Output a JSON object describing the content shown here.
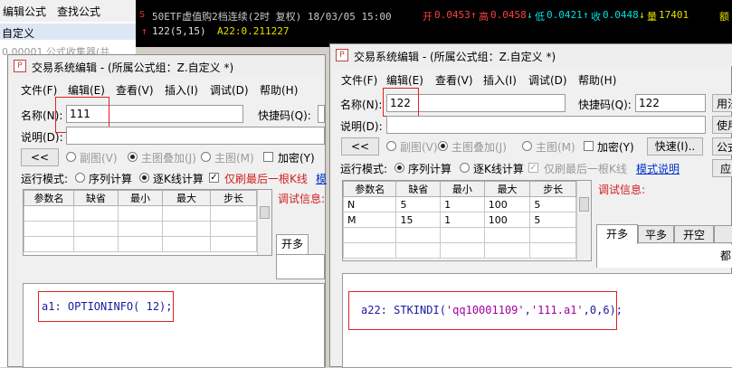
{
  "bg": {
    "menu": [
      "编辑公式",
      "查找公式"
    ],
    "selected": "自定义",
    "item": "0.00001 公式收集器(共"
  },
  "chart": {
    "title": "50ETF虚值购2档连续(2时 复权) 18/03/05 15:00",
    "open_label": "开",
    "open": "0.0453",
    "high_label": "高",
    "high": "0.0458",
    "low_label": "低",
    "low": "0.0421",
    "close_label": "收",
    "close": "0.0448",
    "vol_label": "量",
    "vol": "17401",
    "rest": "额",
    "ind_name": "122(5,15)",
    "ind_val": "A22:0.211227"
  },
  "win1": {
    "title": "交易系统编辑 - (所属公式组：Z.自定义 *)",
    "menu": [
      "文件(F)",
      "编辑(E)",
      "查看(V)",
      "插入(I)",
      "调试(D)",
      "帮助(H)"
    ],
    "name_label": "名称(N):",
    "name_value": "111",
    "shortcut_label": "快捷码(Q):",
    "desc_label": "说明(D):",
    "collapse_btn": "<<",
    "radio_labels": [
      "副图(V)",
      "主图叠加(J)",
      "主图(M)"
    ],
    "encrypt_label": "加密(Y)",
    "run_mode_label": "运行模式:",
    "run_modes": [
      "序列计算",
      "逐K线计算"
    ],
    "refresh_label": "仅刷最后一根K线",
    "extra": "模",
    "columns": [
      "参数名",
      "缺省",
      "最小",
      "最大",
      "步长"
    ],
    "debug_label": "调试信息:",
    "tabs": [
      "开多"
    ],
    "code": "a1: OPTIONINFO( 12);"
  },
  "win2": {
    "title": "交易系统编辑 - (所属公式组：Z.自定义 *)",
    "menu": [
      "文件(F)",
      "编辑(E)",
      "查看(V)",
      "插入(I)",
      "调试(D)",
      "帮助(H)"
    ],
    "name_label": "名称(N):",
    "name_value": "122",
    "shortcut_label": "快捷码(Q):",
    "shortcut_value": "122",
    "desc_label": "说明(D):",
    "collapse_btn": "<<",
    "radio_labels": [
      "副图(V)",
      "主图叠加(J)",
      "主图(M)"
    ],
    "encrypt_label": "加密(Y)",
    "quick_btn": "快速(I)..",
    "run_mode_label": "运行模式:",
    "run_modes": [
      "序列计算",
      "逐K线计算"
    ],
    "refresh_label": "仅刷最后一根K线",
    "mode_link": "模式说明",
    "columns": [
      "参数名",
      "缺省",
      "最小",
      "最大",
      "步长"
    ],
    "rows": [
      [
        "N",
        "5",
        "1",
        "100",
        "5"
      ],
      [
        "M",
        "15",
        "1",
        "100",
        "5"
      ]
    ],
    "debug_label": "调试信息:",
    "tabs": [
      "开多",
      "平多",
      "开空"
    ],
    "tab_extra": "都",
    "right_btns": [
      "用法",
      "使用",
      "公式",
      "应"
    ],
    "code_prefix": "a22: STKINDI(",
    "code_arg1": "'qq10001109'",
    "code_comma": ",",
    "code_arg2": "'111.a1'",
    "code_suffix": ",0,6);"
  }
}
